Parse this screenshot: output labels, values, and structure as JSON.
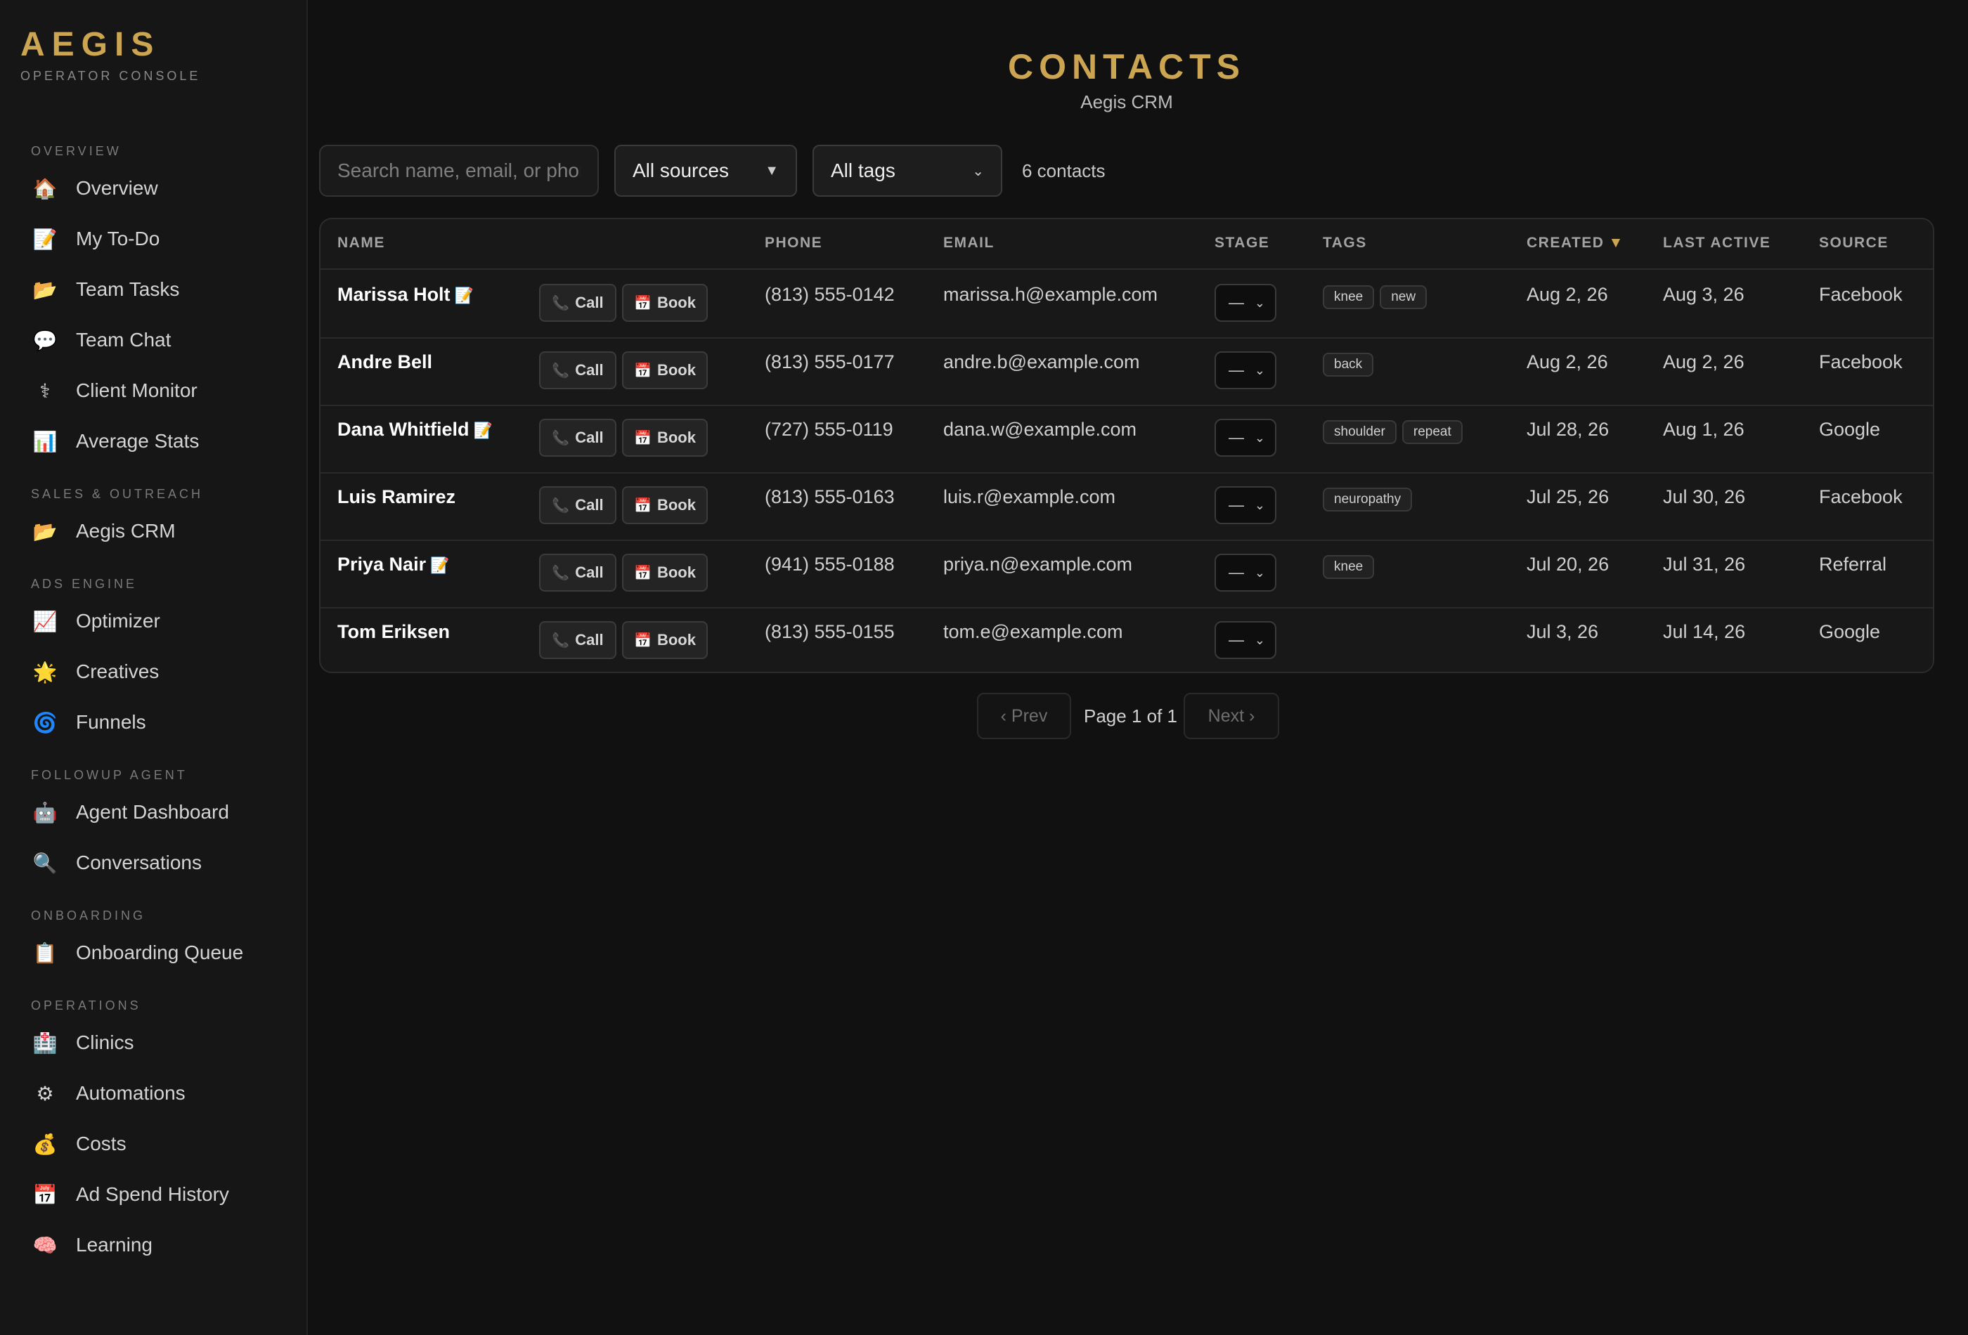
{
  "brand": {
    "title": "AEGIS",
    "subtitle": "OPERATOR CONSOLE"
  },
  "sidebar": {
    "sections": [
      {
        "label": "OVERVIEW",
        "items": [
          {
            "label": "Overview",
            "icon": "🏠",
            "icon_name": "house-icon"
          },
          {
            "label": "My To-Do",
            "icon": "📝",
            "icon_name": "memo-icon"
          },
          {
            "label": "Team Tasks",
            "icon": "📂",
            "icon_name": "folder-icon"
          },
          {
            "label": "Team Chat",
            "icon": "💬",
            "icon_name": "speech-bubble-icon"
          },
          {
            "label": "Client Monitor",
            "icon": "⚕",
            "icon_name": "stethoscope-icon"
          },
          {
            "label": "Average Stats",
            "icon": "📊",
            "icon_name": "bar-chart-icon"
          }
        ]
      },
      {
        "label": "SALES & OUTREACH",
        "items": [
          {
            "label": "Aegis CRM",
            "icon": "📂",
            "icon_name": "folder-icon"
          }
        ]
      },
      {
        "label": "ADS ENGINE",
        "items": [
          {
            "label": "Optimizer",
            "icon": "📈",
            "icon_name": "trending-up-icon"
          },
          {
            "label": "Creatives",
            "icon": "🌟",
            "icon_name": "star-icon"
          },
          {
            "label": "Funnels",
            "icon": "🌀",
            "icon_name": "cyclone-icon"
          }
        ]
      },
      {
        "label": "FOLLOWUP AGENT",
        "items": [
          {
            "label": "Agent Dashboard",
            "icon": "🤖",
            "icon_name": "robot-icon"
          },
          {
            "label": "Conversations",
            "icon": "🔍",
            "icon_name": "magnifier-icon"
          }
        ]
      },
      {
        "label": "ONBOARDING",
        "items": [
          {
            "label": "Onboarding Queue",
            "icon": "📋",
            "icon_name": "clipboard-icon"
          }
        ]
      },
      {
        "label": "OPERATIONS",
        "items": [
          {
            "label": "Clinics",
            "icon": "🏥",
            "icon_name": "hospital-icon"
          },
          {
            "label": "Automations",
            "icon": "⚙",
            "icon_name": "gear-icon"
          },
          {
            "label": "Costs",
            "icon": "💰",
            "icon_name": "money-bag-icon"
          },
          {
            "label": "Ad Spend History",
            "icon": "📅",
            "icon_name": "calendar-icon"
          },
          {
            "label": "Learning",
            "icon": "🧠",
            "icon_name": "brain-icon"
          }
        ]
      }
    ]
  },
  "header": {
    "title": "CONTACTS",
    "subtitle": "Aegis CRM"
  },
  "toolbar": {
    "search_placeholder": "Search name, email, or phone",
    "source_filter": "All sources",
    "tag_filter": "All tags",
    "count_label": "6 contacts"
  },
  "table": {
    "columns": {
      "name": "NAME",
      "phone": "PHONE",
      "email": "EMAIL",
      "stage": "STAGE",
      "tags": "TAGS",
      "created": "CREATED",
      "last_active": "LAST ACTIVE",
      "source": "SOURCE"
    },
    "sort_indicator": "▼",
    "call_label": "Call",
    "book_label": "Book",
    "call_icon": "📞",
    "book_icon": "📅",
    "note_icon": "📝",
    "stage_placeholder": "—",
    "rows": [
      {
        "name": "Marissa Holt",
        "has_note": true,
        "phone": "(813) 555-0142",
        "email": "marissa.h@example.com",
        "tags": [
          "knee",
          "new"
        ],
        "created": "Aug 2, 26",
        "last_active": "Aug 3, 26",
        "source": "Facebook"
      },
      {
        "name": "Andre Bell",
        "has_note": false,
        "phone": "(813) 555-0177",
        "email": "andre.b@example.com",
        "tags": [
          "back"
        ],
        "created": "Aug 2, 26",
        "last_active": "Aug 2, 26",
        "source": "Facebook"
      },
      {
        "name": "Dana Whitfield",
        "has_note": true,
        "phone": "(727) 555-0119",
        "email": "dana.w@example.com",
        "tags": [
          "shoulder",
          "repeat"
        ],
        "created": "Jul 28, 26",
        "last_active": "Aug 1, 26",
        "source": "Google"
      },
      {
        "name": "Luis Ramirez",
        "has_note": false,
        "phone": "(813) 555-0163",
        "email": "luis.r@example.com",
        "tags": [
          "neuropathy"
        ],
        "created": "Jul 25, 26",
        "last_active": "Jul 30, 26",
        "source": "Facebook"
      },
      {
        "name": "Priya Nair",
        "has_note": true,
        "phone": "(941) 555-0188",
        "email": "priya.n@example.com",
        "tags": [
          "knee"
        ],
        "created": "Jul 20, 26",
        "last_active": "Jul 31, 26",
        "source": "Referral"
      },
      {
        "name": "Tom Eriksen",
        "has_note": false,
        "phone": "(813) 555-0155",
        "email": "tom.e@example.com",
        "tags": [],
        "created": "Jul 3, 26",
        "last_active": "Jul 14, 26",
        "source": "Google"
      }
    ]
  },
  "pagination": {
    "prev_label": "‹ Prev",
    "page_label": "Page 1 of 1",
    "next_label": "Next ›"
  },
  "colors": {
    "accent": "#cba552",
    "background": "#111111",
    "sidebar": "#161616"
  }
}
